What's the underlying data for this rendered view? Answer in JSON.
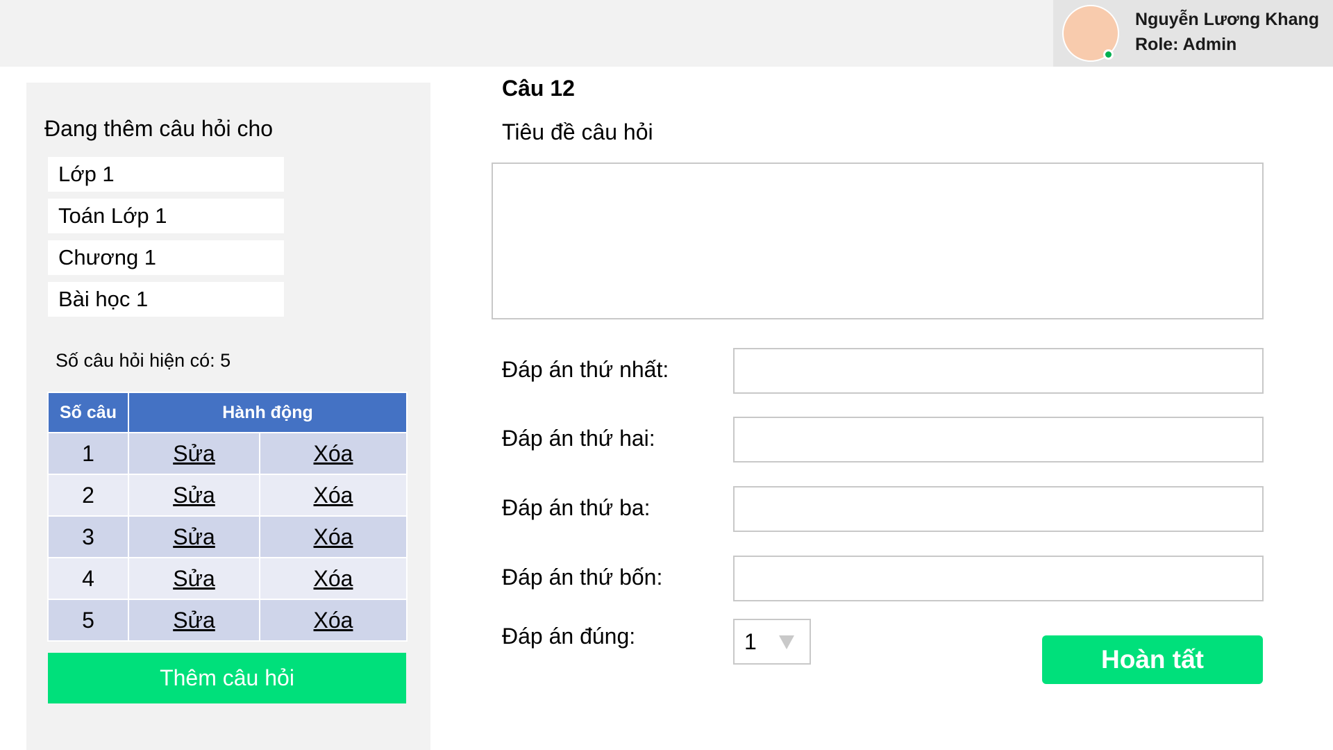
{
  "user": {
    "name": "Nguyễn Lương Khang",
    "role": "Role: Admin"
  },
  "left_panel": {
    "heading": "Đang thêm câu hỏi cho",
    "context": [
      "Lớp 1",
      "Toán Lớp 1",
      "Chương 1",
      "Bài học 1"
    ],
    "count_text": "Số câu hỏi hiện có: 5",
    "table": {
      "headers": [
        "Số câu",
        "Hành động"
      ],
      "rows": [
        {
          "num": "1",
          "edit": "Sửa",
          "delete": "Xóa"
        },
        {
          "num": "2",
          "edit": "Sửa",
          "delete": "Xóa"
        },
        {
          "num": "3",
          "edit": "Sửa",
          "delete": "Xóa"
        },
        {
          "num": "4",
          "edit": "Sửa",
          "delete": "Xóa"
        },
        {
          "num": "5",
          "edit": "Sửa",
          "delete": "Xóa"
        }
      ]
    },
    "add_button": "Thêm câu hỏi"
  },
  "form": {
    "question_number": "Câu 12",
    "title_label": "Tiêu đề câu hỏi",
    "title_value": "",
    "answers": [
      {
        "label": "Đáp án thứ nhất:",
        "value": ""
      },
      {
        "label": "Đáp án thứ hai:",
        "value": ""
      },
      {
        "label": "Đáp án thứ ba:",
        "value": ""
      },
      {
        "label": "Đáp án thứ bốn:",
        "value": ""
      }
    ],
    "correct_label": "Đáp án đúng:",
    "correct_value": "1",
    "submit_label": "Hoàn tất"
  },
  "colors": {
    "accent_green": "#00e07b",
    "table_header": "#4472c4",
    "row_odd": "#cfd5ea",
    "row_even": "#e9ebf5",
    "status_online": "#00b050",
    "avatar": "#f8cbad"
  }
}
